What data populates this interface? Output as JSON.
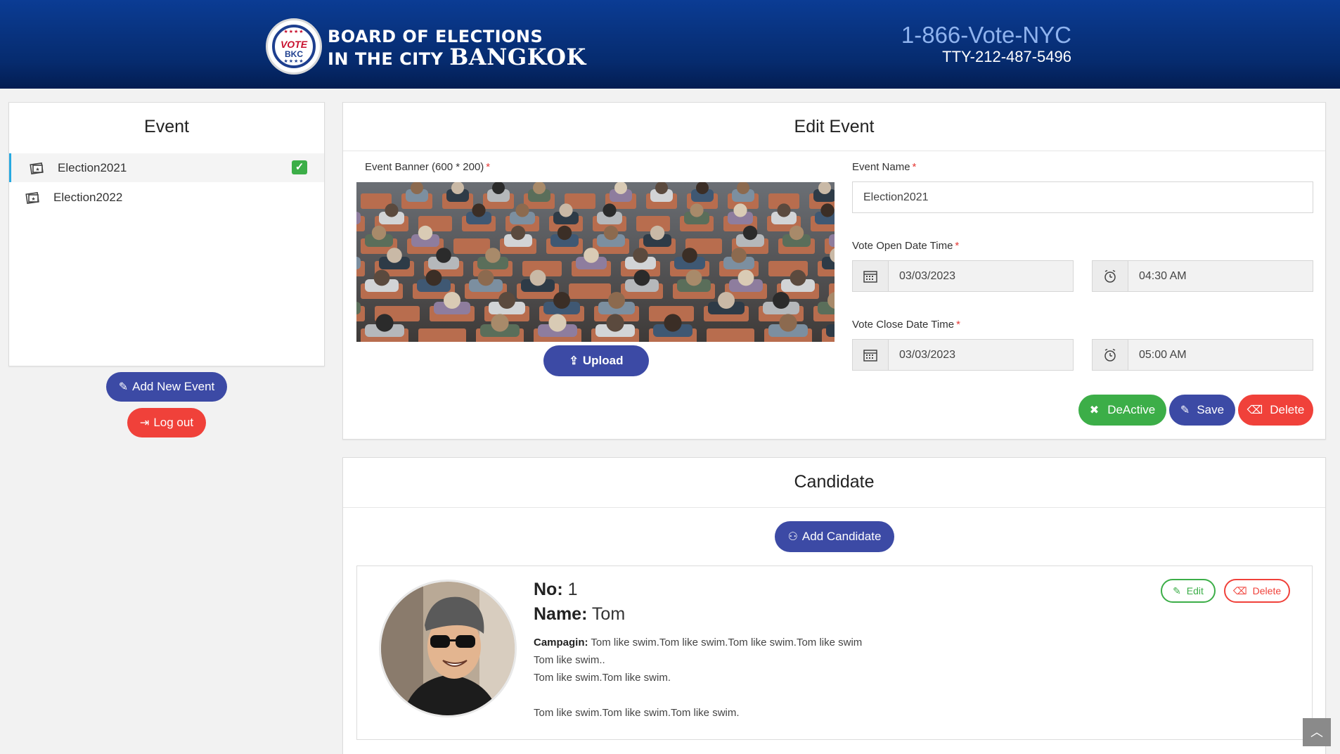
{
  "header": {
    "logo_vote": "VOTE",
    "logo_bkc": "BKC",
    "brand_line1": "BOARD OF ELECTIONS",
    "brand_line2_prefix": "IN THE CITY",
    "brand_line2_city": "BANGKOK",
    "phone": "1-866-Vote-NYC",
    "tty": "TTY-212-487-5496"
  },
  "event_list": {
    "title": "Event",
    "items": [
      {
        "label": "Election2021",
        "selected": true
      },
      {
        "label": "Election2022",
        "selected": false
      }
    ],
    "add_button": "Add New Event",
    "logout_button": "Log out"
  },
  "edit_event": {
    "title": "Edit Event",
    "banner_label": "Event Banner (600 * 200)",
    "upload_button": "Upload",
    "name_label": "Event Name",
    "name_value": "Election2021",
    "open_label": "Vote Open Date Time",
    "open_date": "03/03/2023",
    "open_time": "04:30 AM",
    "close_label": "Vote Close Date Time",
    "close_date": "03/03/2023",
    "close_time": "05:00 AM",
    "required_mark": "*",
    "deactive_button": "DeActive",
    "save_button": "Save",
    "delete_button": "Delete"
  },
  "candidates": {
    "title": "Candidate",
    "add_button": "Add Candidate",
    "items": [
      {
        "no_label": "No:",
        "no": "1",
        "name_label": "Name:",
        "name": "Tom",
        "campaign_label": "Campagin:",
        "campaign_line1": "Tom like swim.Tom like swim.Tom like swim.Tom like swim",
        "campaign_line2": "Tom like swim..",
        "campaign_line3": "Tom like swim.Tom like swim.",
        "campaign_line4": "Tom like swim.Tom like swim.Tom like swim.",
        "edit_button": "Edit",
        "delete_button": "Delete"
      }
    ]
  },
  "colors": {
    "header_blue": "#0b3c94",
    "primary": "#3c4aa5",
    "danger": "#f0413a",
    "success": "#3cae48",
    "active_border": "#27a9e1"
  }
}
